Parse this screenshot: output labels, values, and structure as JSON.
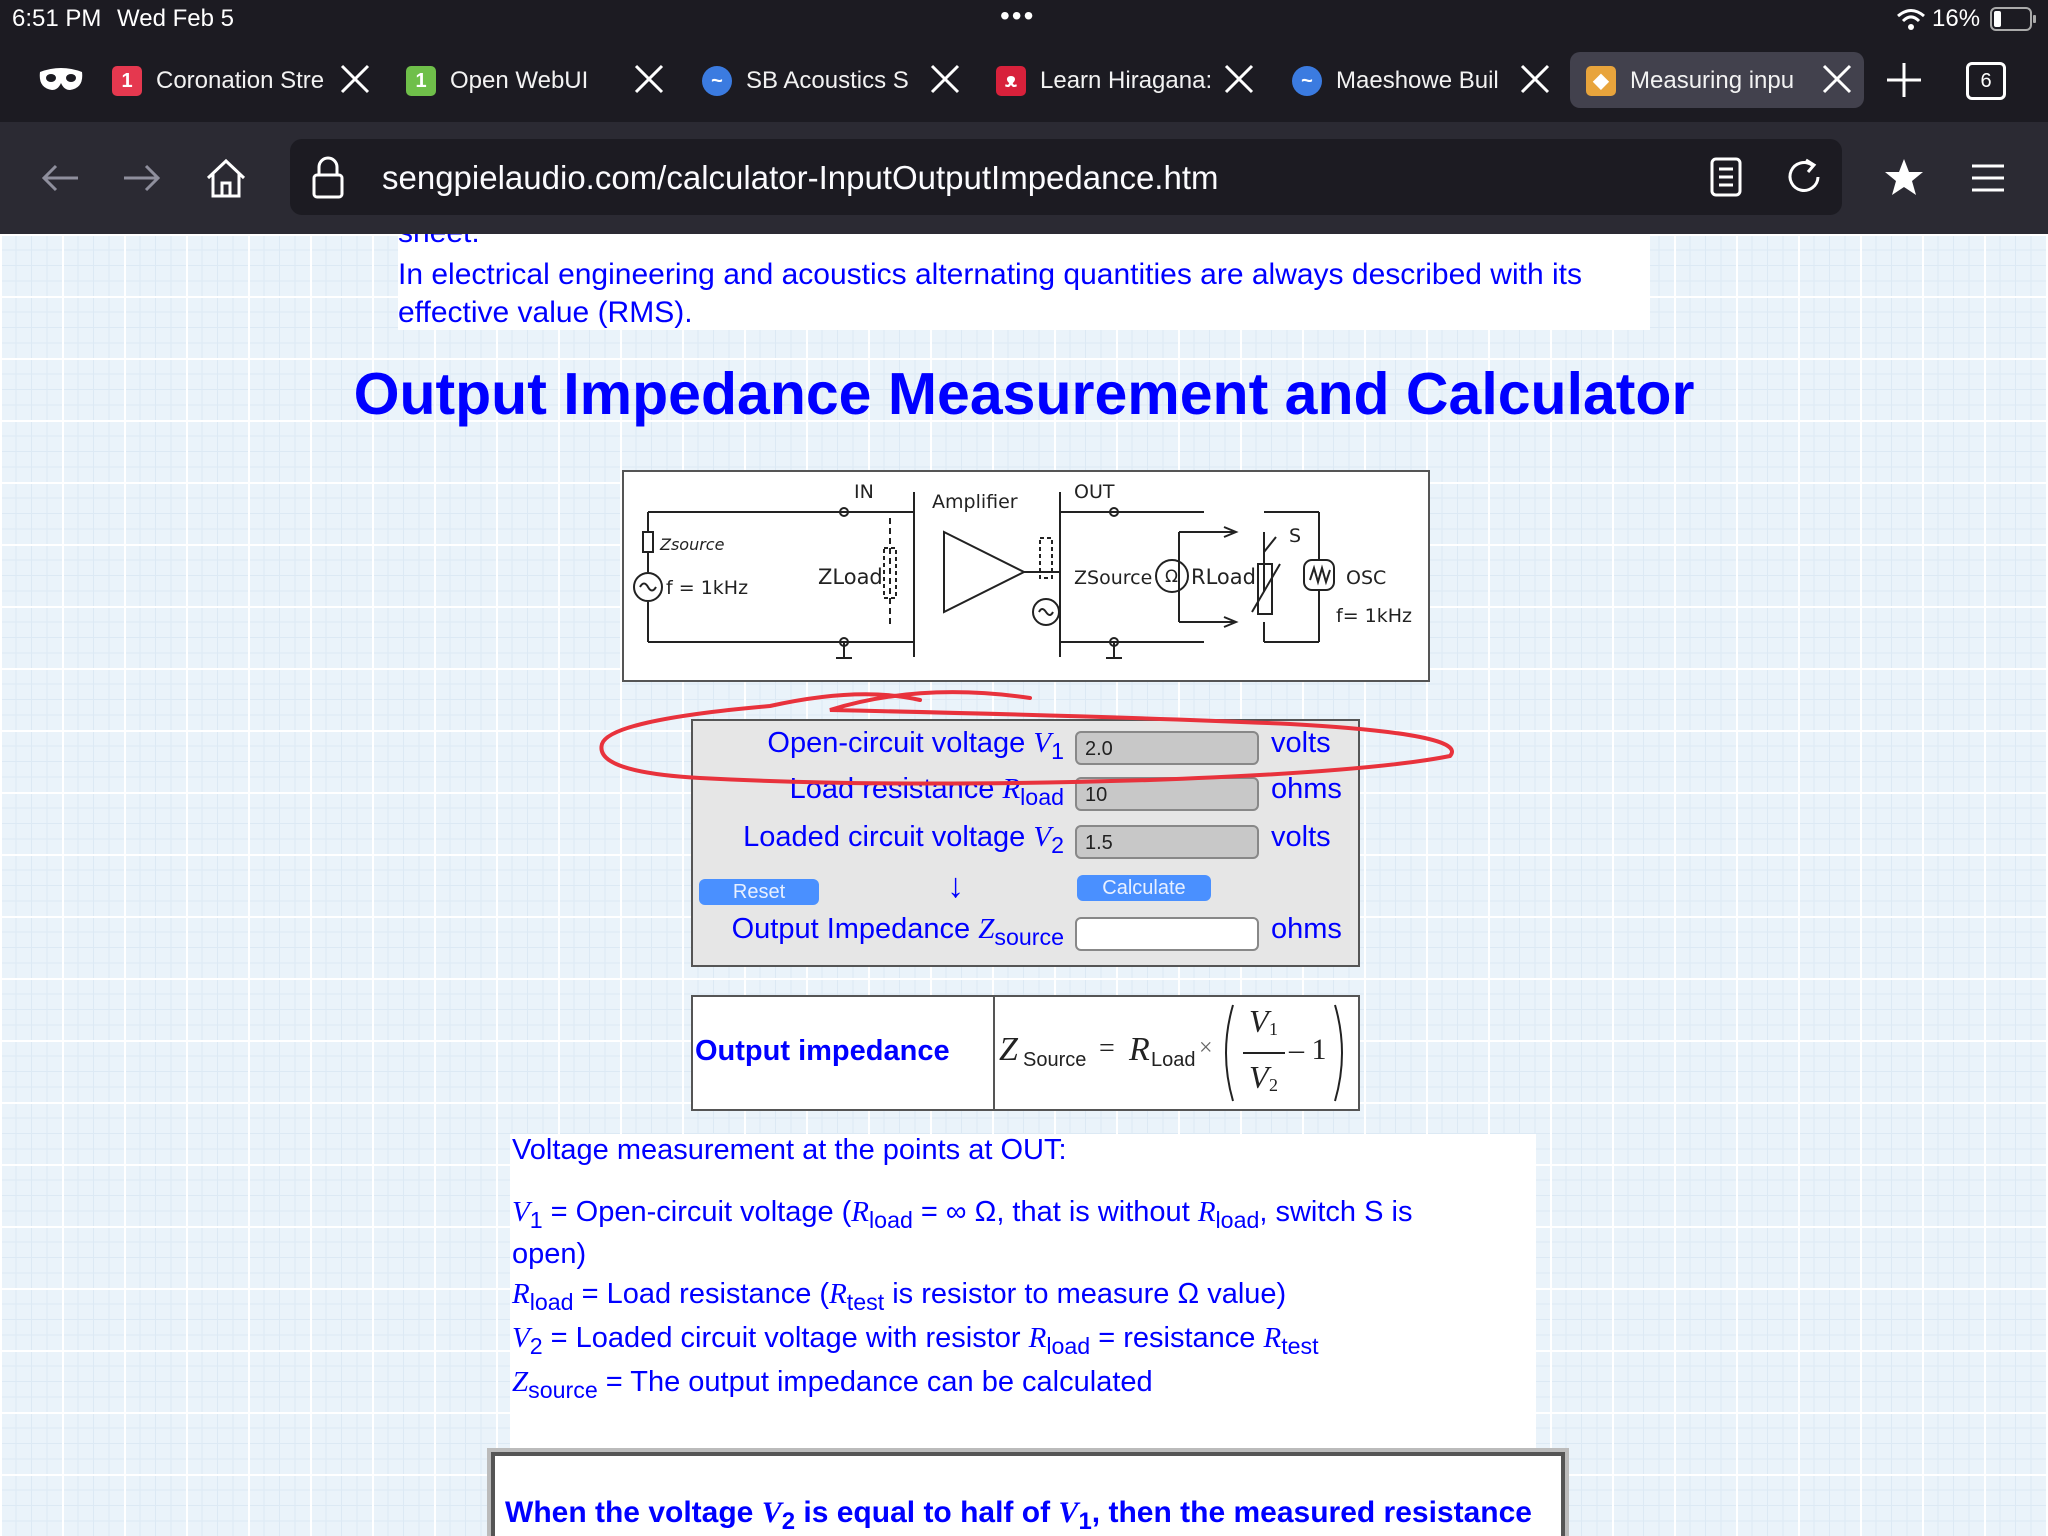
{
  "status_bar": {
    "time": "6:51 PM",
    "date": "Wed Feb 5",
    "battery": "16%"
  },
  "tabs": [
    {
      "badge": "1",
      "badge_color": "#e5384f",
      "title": "Coronation Stre"
    },
    {
      "badge": "1",
      "badge_color": "#6fbf4a",
      "title": "Open WebUI"
    },
    {
      "badge": "",
      "badge_color": "#3b7be0",
      "title": "SB Acoustics S"
    },
    {
      "badge": "",
      "badge_color": "#d8213b",
      "title": "Learn Hiragana:"
    },
    {
      "badge": "",
      "badge_color": "#3b7be0",
      "title": "Maeshowe Buil"
    },
    {
      "badge": "",
      "badge_color": "#e8a43c",
      "title": "Measuring inpu"
    }
  ],
  "tab_count": "6",
  "url": "sengpielaudio.com/calculator-InputOutputImpedance.htm",
  "intro": {
    "fragment": "sheet.",
    "text_1": "In electrical engineering and acoustics alternating quantities are always described with its",
    "text_2": "effective value (RMS)."
  },
  "heading": "Output Impedance Measurement and Calculator",
  "diagram": {
    "in": "IN",
    "out": "OUT",
    "amplifier": "Amplifier",
    "zsource_left": "Zsource",
    "freq_left": "f = 1kHz",
    "zload": "ZLoad",
    "zsource_right": "ZSource",
    "rload": "RLoad",
    "switch": "S",
    "osc": "OSC",
    "freq_right": "f= 1kHz"
  },
  "calculator": {
    "v1_label": "Open-circuit voltage",
    "v1_var": "V",
    "v1_sub": "1",
    "v1_value": "2.0",
    "v1_unit": "volts",
    "rload_label": "Load resistance",
    "rload_var": "R",
    "rload_sub": "load",
    "rload_value": "10",
    "rload_unit": "ohms",
    "v2_label": "Loaded circuit voltage",
    "v2_var": "V",
    "v2_sub": "2",
    "v2_value": "1.5",
    "v2_unit": "volts",
    "reset_label": "Reset",
    "arrow": "↓",
    "calculate_label": "Calculate",
    "z_label": "Output Impedance",
    "z_var": "Z",
    "z_sub": "source",
    "z_value": "",
    "z_unit": "ohms"
  },
  "formula": {
    "label": "Output impedance",
    "lhs_var": "Z",
    "lhs_sub": "Source",
    "eq": "=",
    "r_var": "R",
    "r_sub": "Load",
    "times": "×",
    "num_var": "V",
    "num_sub": "1",
    "den_var": "V",
    "den_sub": "2",
    "minus_one": "– 1"
  },
  "description": {
    "title": "Voltage measurement at the points at OUT:",
    "v1_sym": "V",
    "v1_sub": "1",
    "v1_text_a": " = Open-circuit voltage (",
    "r_sym": "R",
    "load_sub": "load",
    "v1_text_b": " = ∞ Ω, that is without ",
    "v1_text_c": ", switch S is",
    "v1_text_d": "open)",
    "rload_text_a": " = Load resistance (",
    "test_sub": "test",
    "rload_text_b": " is resistor to measure Ω value)",
    "v2_sym": "V",
    "v2_sub": "2",
    "v2_text_a": " = Loaded circuit voltage with resistor ",
    "v2_text_b": " = resistance ",
    "z_sym": "Z",
    "z_sub": "source",
    "z_text": " = The output impedance can be calculated"
  },
  "note": {
    "a": "When the voltage ",
    "v2": "V",
    "v2_sub": "2",
    "b": " is equal to half of ",
    "v1": "V",
    "v1_sub": "1",
    "c": ", then the measured resistance"
  },
  "annotation_color": "#e8323c"
}
